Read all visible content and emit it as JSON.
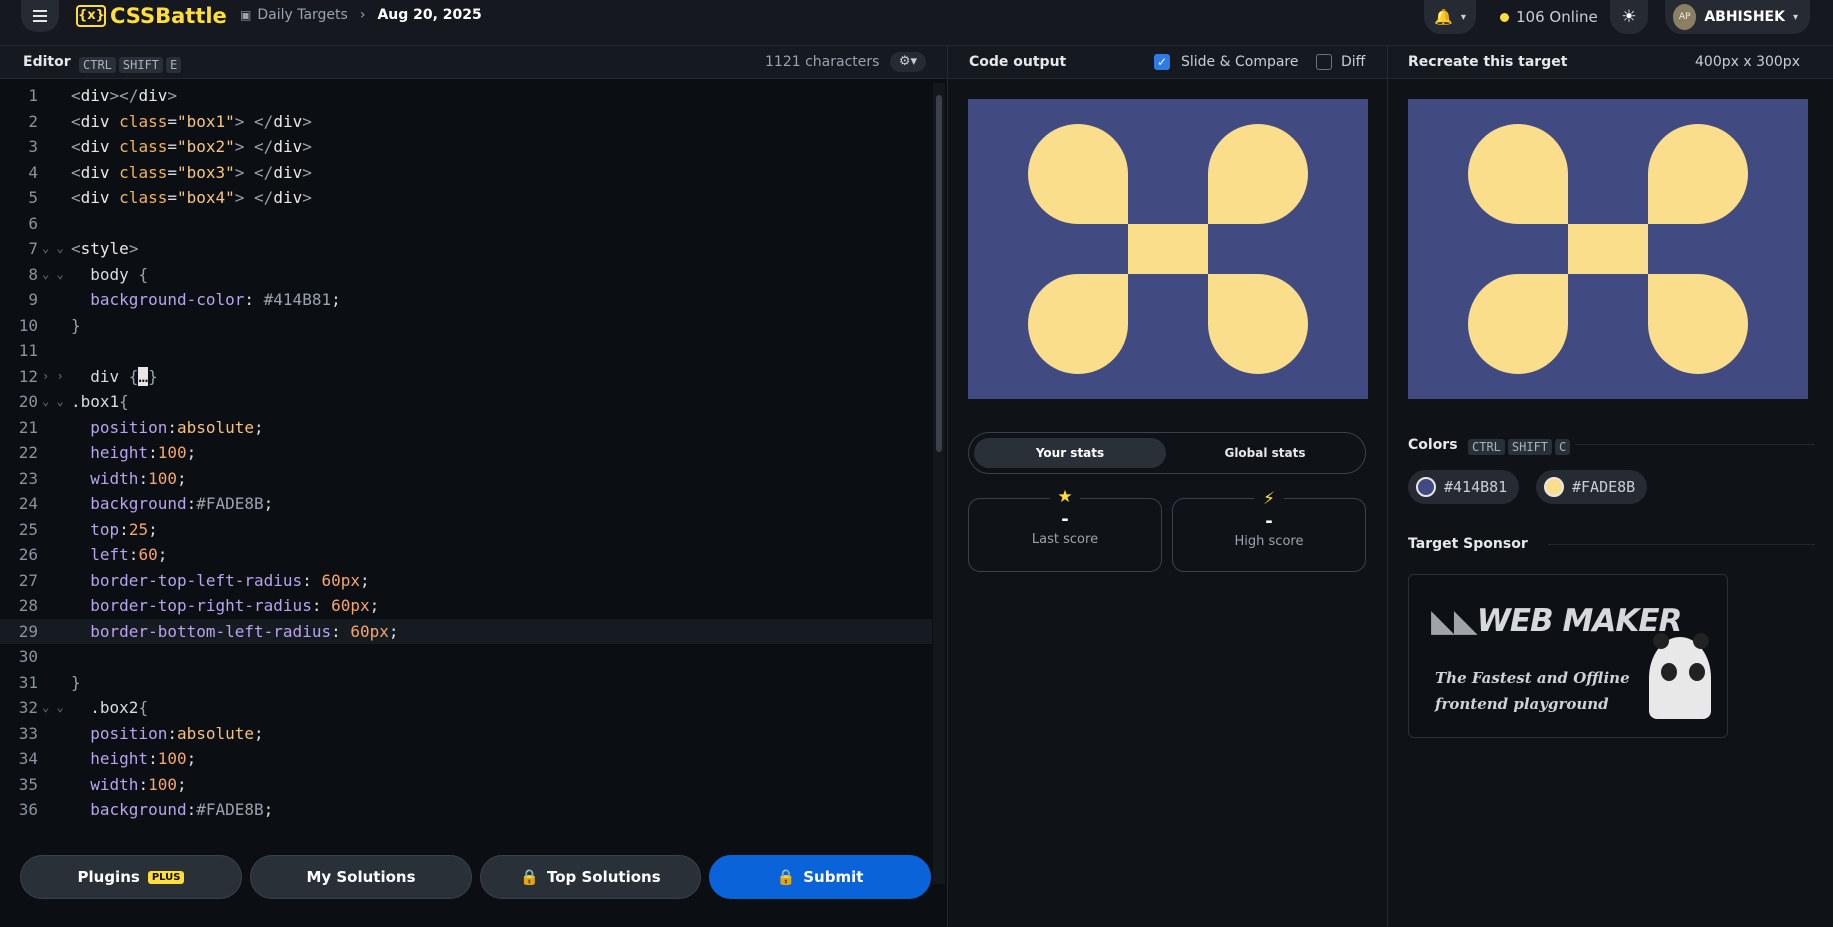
{
  "header": {
    "logo": "CSSBattle",
    "logo_mark": "{x}",
    "breadcrumb_section": "Daily Targets",
    "breadcrumb_date": "Aug 20, 2025",
    "online_count": "106 Online",
    "username": "ABHISHEK",
    "avatar_initials": "AP"
  },
  "editor": {
    "title": "Editor",
    "shortcut": [
      "CTRL",
      "SHIFT",
      "E"
    ],
    "char_count": "1121 characters",
    "lines": [
      {
        "n": "1",
        "fold": "",
        "html": "<span class='c-br'>&lt;</span><span class='c-tag'>div</span><span class='c-br'>&gt;&lt;/</span><span class='c-tag'>div</span><span class='c-br'>&gt;</span>"
      },
      {
        "n": "2",
        "fold": "",
        "html": "<span class='c-br'>&lt;</span><span class='c-tag'>div </span><span class='c-attr'>class</span><span class='c-plain'>=</span><span class='c-str'>\"box1\"</span><span class='c-br'>&gt; &lt;/</span><span class='c-tag'>div</span><span class='c-br'>&gt;</span>"
      },
      {
        "n": "3",
        "fold": "",
        "html": "<span class='c-br'>&lt;</span><span class='c-tag'>div </span><span class='c-attr'>class</span><span class='c-plain'>=</span><span class='c-str'>\"box2\"</span><span class='c-br'>&gt; &lt;/</span><span class='c-tag'>div</span><span class='c-br'>&gt;</span>"
      },
      {
        "n": "4",
        "fold": "",
        "html": "<span class='c-br'>&lt;</span><span class='c-tag'>div </span><span class='c-attr'>class</span><span class='c-plain'>=</span><span class='c-str'>\"box3\"</span><span class='c-br'>&gt; &lt;/</span><span class='c-tag'>div</span><span class='c-br'>&gt;</span>"
      },
      {
        "n": "5",
        "fold": "",
        "html": "<span class='c-br'>&lt;</span><span class='c-tag'>div </span><span class='c-attr'>class</span><span class='c-plain'>=</span><span class='c-str'>\"box4\"</span><span class='c-br'>&gt; &lt;/</span><span class='c-tag'>div</span><span class='c-br'>&gt;</span>"
      },
      {
        "n": "6",
        "fold": "",
        "html": ""
      },
      {
        "n": "7",
        "fold": "⌄",
        "html": "<span class='c-br'>&lt;</span><span class='c-tag'>style</span><span class='c-br'>&gt;</span>"
      },
      {
        "n": "8",
        "fold": "⌄",
        "html": "  <span class='c-plain'>body </span><span class='c-br'>{</span>"
      },
      {
        "n": "9",
        "fold": "",
        "html": "  <span class='c-prop'>background-color</span><span class='c-plain'>: </span><span class='c-br'>#414B81</span><span class='c-plain'>;</span>"
      },
      {
        "n": "10",
        "fold": "",
        "html": "<span class='c-br'>}</span>"
      },
      {
        "n": "11",
        "fold": "",
        "html": ""
      },
      {
        "n": "12",
        "fold": "›",
        "html": "  <span class='c-plain'>div </span><span class='c-br'>{</span><span class='c-plain' style='background:#e6e6e6;color:#111'>…</span><span class='c-br'>}</span>"
      },
      {
        "n": "20",
        "fold": "⌄",
        "html": "<span class='c-plain'>.box1</span><span class='c-br'>{</span>"
      },
      {
        "n": "21",
        "fold": "",
        "html": "  <span class='c-prop'>position</span><span class='c-plain'>:</span><span class='c-val'>absolute</span><span class='c-plain'>;</span>"
      },
      {
        "n": "22",
        "fold": "",
        "html": "  <span class='c-prop'>height</span><span class='c-plain'>:</span><span class='c-num'>100</span><span class='c-plain'>;</span>"
      },
      {
        "n": "23",
        "fold": "",
        "html": "  <span class='c-prop'>width</span><span class='c-plain'>:</span><span class='c-num'>100</span><span class='c-plain'>;</span>"
      },
      {
        "n": "24",
        "fold": "",
        "html": "  <span class='c-prop'>background</span><span class='c-plain'>:</span><span class='c-br'>#FADE8B</span><span class='c-plain'>;</span>"
      },
      {
        "n": "25",
        "fold": "",
        "html": "  <span class='c-prop'>top</span><span class='c-plain'>:</span><span class='c-num'>25</span><span class='c-plain'>;</span>"
      },
      {
        "n": "26",
        "fold": "",
        "html": "  <span class='c-prop'>left</span><span class='c-plain'>:</span><span class='c-num'>60</span><span class='c-plain'>;</span>"
      },
      {
        "n": "27",
        "fold": "",
        "html": "  <span class='c-prop'>border-top-left-radius</span><span class='c-plain'>: </span><span class='c-num'>60px</span><span class='c-plain'>;</span>"
      },
      {
        "n": "28",
        "fold": "",
        "html": "  <span class='c-prop'>border-top-right-radius</span><span class='c-plain'>: </span><span class='c-num'>60px</span><span class='c-plain'>;</span>"
      },
      {
        "n": "29",
        "fold": "",
        "html": "  <span class='c-prop'>border-bottom-left-radius</span><span class='c-plain'>: </span><span class='c-num'>60px</span><span class='c-plain'>;</span>",
        "active": true
      },
      {
        "n": "30",
        "fold": "",
        "html": ""
      },
      {
        "n": "31",
        "fold": "",
        "html": "<span class='c-br'>}</span>"
      },
      {
        "n": "32",
        "fold": "⌄",
        "html": "  <span class='c-plain'>.box2</span><span class='c-br'>{</span>"
      },
      {
        "n": "33",
        "fold": "",
        "html": "  <span class='c-prop'>position</span><span class='c-plain'>:</span><span class='c-val'>absolute</span><span class='c-plain'>;</span>"
      },
      {
        "n": "34",
        "fold": "",
        "html": "  <span class='c-prop'>height</span><span class='c-plain'>:</span><span class='c-num'>100</span><span class='c-plain'>;</span>"
      },
      {
        "n": "35",
        "fold": "",
        "html": "  <span class='c-prop'>width</span><span class='c-plain'>:</span><span class='c-num'>100</span><span class='c-plain'>;</span>"
      },
      {
        "n": "36",
        "fold": "",
        "html": "  <span class='c-prop'>background</span><span class='c-plain'>:</span><span class='c-br'>#FADE8B</span><span class='c-plain'>;</span>"
      }
    ]
  },
  "buttons": {
    "plugins": "Plugins",
    "plugins_badge": "PLUS",
    "my_solutions": "My Solutions",
    "top_solutions": "Top Solutions",
    "submit": "Submit"
  },
  "output": {
    "title": "Code output",
    "slide_compare": "Slide & Compare",
    "slide_compare_checked": true,
    "diff": "Diff",
    "diff_checked": false,
    "tab_your_stats": "Your stats",
    "tab_global_stats": "Global stats",
    "last_score_value": "-",
    "last_score_label": "Last score",
    "high_score_value": "-",
    "high_score_label": "High score"
  },
  "target": {
    "title": "Recreate this target",
    "size": "400px x 300px",
    "colors_title": "Colors",
    "colors_shortcut": [
      "CTRL",
      "SHIFT",
      "C"
    ],
    "colors": [
      {
        "hex": "#414B81",
        "label": "#414B81"
      },
      {
        "hex": "#FADE8B",
        "label": "#FADE8B"
      }
    ],
    "sponsor_title": "Target Sponsor",
    "sponsor_name": "WEB MAKER",
    "sponsor_tagline_1": "The Fastest and Offline",
    "sponsor_tagline_2": "frontend playground"
  },
  "theme": {
    "background": "#414B81",
    "shape": "#FADE8B",
    "accent_yellow": "#ffde3b",
    "submit_blue": "#0a63d9"
  }
}
